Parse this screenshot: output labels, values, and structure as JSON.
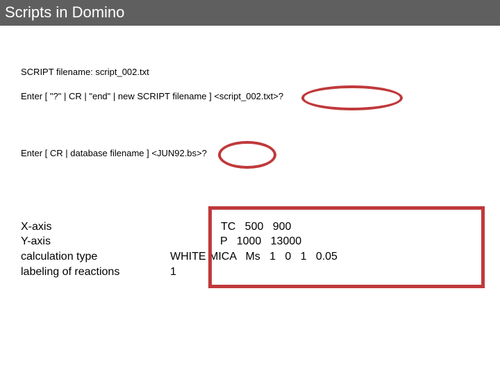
{
  "header": {
    "title": "Scripts in Domino"
  },
  "console": {
    "line1": "SCRIPT filename: script_002.txt",
    "line2": "Enter [ \"?\" | CR | \"end\" | new SCRIPT filename ] <script_002.txt>?",
    "line3": "Enter [ CR | database filename ] <JUN92.bs>?"
  },
  "settings": [
    {
      "label": "X-axis",
      "value": "TC   500   900"
    },
    {
      "label": "Y-axis",
      "value": "P   1000   13000"
    },
    {
      "label": "calculation type",
      "value": "WHITE MICA   Ms   1   0   1   0.05"
    },
    {
      "label": "labeling of reactions",
      "value": "1"
    }
  ],
  "highlight_color": "#c0393b"
}
